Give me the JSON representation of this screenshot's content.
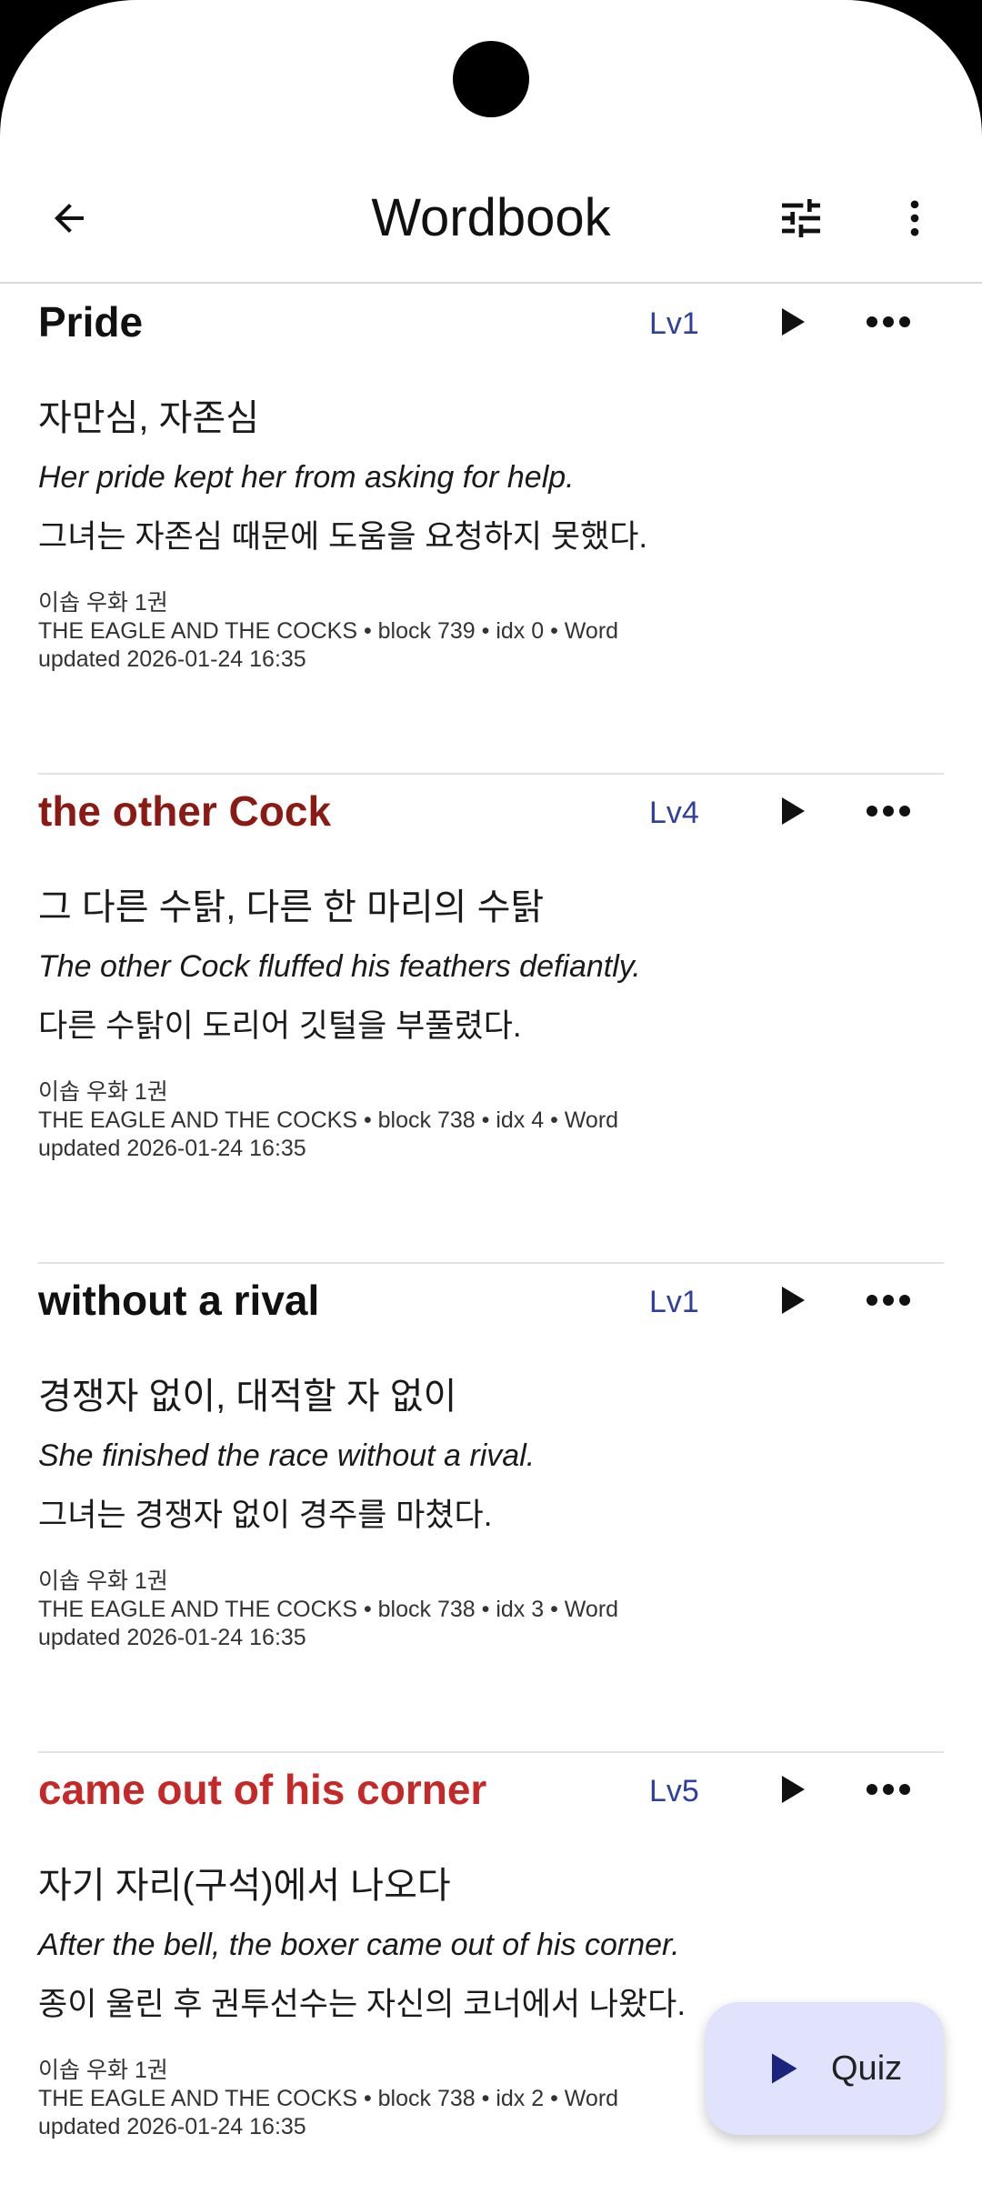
{
  "appbar": {
    "title": "Wordbook",
    "back_icon": "arrow-back-icon",
    "filter_icon": "tune-icon",
    "more_icon": "more-vert-icon"
  },
  "entries": [
    {
      "term": "Pride",
      "level": "Lv1",
      "meaning": "자만심, 자존심",
      "example": "Her pride kept her from asking for help.",
      "translation": "그녀는 자존심 때문에 도움을 요청하지 못했다.",
      "book": "이솝 우화 1권",
      "source": "THE EAGLE AND THE COCKS • block 739 • idx 0 • Word",
      "updated": "updated 2026-01-24 16:35",
      "color": "#111111"
    },
    {
      "term": "the other Cock",
      "level": "Lv4",
      "meaning": "그 다른 수탉, 다른 한 마리의 수탉",
      "example": "The other Cock fluffed his feathers defiantly.",
      "translation": "다른 수탉이 도리어 깃털을 부풀렸다.",
      "book": "이솝 우화 1권",
      "source": "THE EAGLE AND THE COCKS • block 738 • idx 4 • Word",
      "updated": "updated 2026-01-24 16:35",
      "color": "#8b1a14"
    },
    {
      "term": "without a rival",
      "level": "Lv1",
      "meaning": "경쟁자 없이, 대적할 자 없이",
      "example": "She finished the race without a rival.",
      "translation": "그녀는 경쟁자 없이 경주를 마쳤다.",
      "book": "이솝 우화 1권",
      "source": "THE EAGLE AND THE COCKS • block 738 • idx 3 • Word",
      "updated": "updated 2026-01-24 16:35",
      "color": "#111111"
    },
    {
      "term": "came out of his corner",
      "level": "Lv5",
      "meaning": "자기 자리(구석)에서 나오다",
      "example": "After the bell, the boxer came out of his corner.",
      "translation": "종이 울린 후 권투선수는 자신의 코너에서 나왔다.",
      "book": "이솝 우화 1권",
      "source": "THE EAGLE AND THE COCKS • block 738 • idx 2 • Word",
      "updated": "updated 2026-01-24 16:35",
      "color": "#c62828"
    }
  ],
  "fab": {
    "label": "Quiz",
    "icon": "play-icon",
    "background": "#e0e3fb"
  },
  "colors": {
    "level_text": "#2e3f9e",
    "divider": "#e2e2e2"
  }
}
